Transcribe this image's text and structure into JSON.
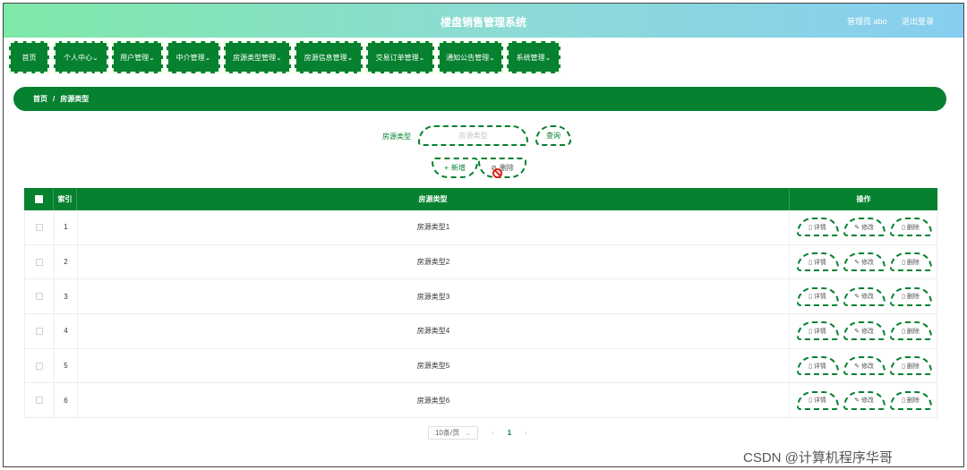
{
  "app": {
    "title": "楼盘销售管理系统",
    "user_label": "管理员 abo",
    "logout_label": "退出登录"
  },
  "nav": [
    {
      "label": "首页"
    },
    {
      "label": "个人中心"
    },
    {
      "label": "用户管理"
    },
    {
      "label": "中介管理"
    },
    {
      "label": "房源类型管理"
    },
    {
      "label": "房源信息管理"
    },
    {
      "label": "交易订单管理"
    },
    {
      "label": "通知公告管理"
    },
    {
      "label": "系统管理"
    }
  ],
  "breadcrumb": {
    "home": "首页",
    "separator": "/",
    "current": "房源类型"
  },
  "search": {
    "label": "房源类型",
    "placeholder": "房源类型",
    "query_button": "查询"
  },
  "actions": {
    "add_button": "新增",
    "delete_button": "删除"
  },
  "table": {
    "headers": {
      "index": "索引",
      "type": "房源类型",
      "ops": "操作"
    },
    "op_labels": {
      "detail": "详情",
      "edit": "修改",
      "delete": "删除"
    },
    "rows": [
      {
        "index": "1",
        "type": "房源类型1"
      },
      {
        "index": "2",
        "type": "房源类型2"
      },
      {
        "index": "3",
        "type": "房源类型3"
      },
      {
        "index": "4",
        "type": "房源类型4"
      },
      {
        "index": "5",
        "type": "房源类型5"
      },
      {
        "index": "6",
        "type": "房源类型6"
      }
    ]
  },
  "pagination": {
    "page_size": "10条/页",
    "current_page": "1"
  },
  "watermark": "CSDN @计算机程序华哥",
  "colors": {
    "primary": "#05812f",
    "header_start": "#7ee8a8",
    "header_end": "#88cdf0"
  },
  "icons": {
    "chevron": "chevron-down-icon",
    "add": "plus-icon",
    "delete": "trash-icon",
    "detail": "document-icon",
    "edit": "edit-icon"
  }
}
